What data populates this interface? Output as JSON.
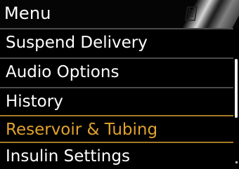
{
  "header": {
    "title": "Menu",
    "icon": "notebook-icon"
  },
  "menu": {
    "items": [
      {
        "label": "Suspend Delivery"
      },
      {
        "label": "Audio Options"
      },
      {
        "label": "History"
      },
      {
        "label": "Reservoir & Tubing",
        "selected": true
      },
      {
        "label": "Insulin Settings"
      }
    ]
  },
  "colors": {
    "background": "#000000",
    "text": "#ffffff",
    "selected_text": "#e2a22d",
    "selected_border": "#a47a26",
    "separator": "#4a4a4a"
  }
}
